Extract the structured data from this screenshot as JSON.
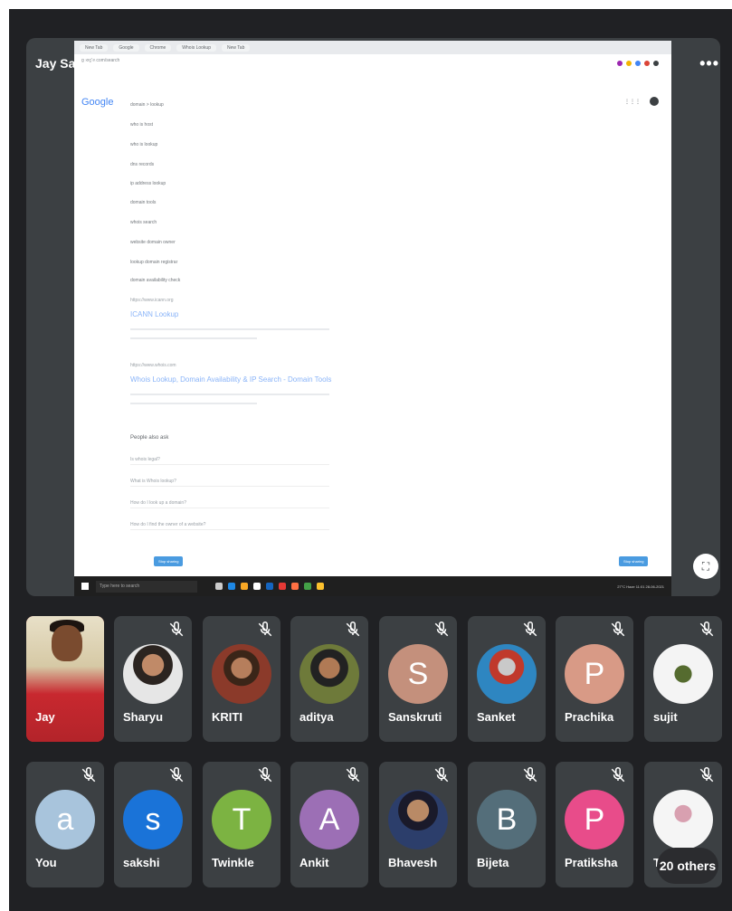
{
  "presenter": {
    "name": "Jay Sankh"
  },
  "toolbar": {
    "more_label": "•••",
    "fullscreen_icon": "fullscreen-icon"
  },
  "shared_screen": {
    "tabs": [
      "New Tab",
      "Google",
      "Chrome",
      "Whois Lookup",
      "New Tab"
    ],
    "address": "google.com/search",
    "google_logo": "Google",
    "suggestions": [
      "domain > lookup",
      "who is host",
      "who is lookup",
      "dns records",
      "ip address lookup",
      "domain tools",
      "whois search",
      "website domain owner",
      "lookup domain registrar",
      "domain availability check"
    ],
    "result1": {
      "url": "https://www.icann.org",
      "title": "ICANN Lookup"
    },
    "result2": {
      "url": "https://www.whois.com",
      "title": "Whois Lookup, Domain Availability & IP Search - Domain Tools"
    },
    "paa_heading": "People also ask",
    "paa": [
      "Is whois legal?",
      "What is Whois lookup?",
      "How do I look up a domain?",
      "How do I find the owner of a website?"
    ],
    "stop_label": "Stop sharing",
    "taskbar_search": "Type here to search",
    "tray_text": "27°C Haze  11:01  28-06-2021"
  },
  "row1": [
    {
      "name": "Jay",
      "initial": "",
      "color": ""
    },
    {
      "name": "Sharyu",
      "initial": "",
      "color": ""
    },
    {
      "name": "KRITI",
      "initial": "",
      "color": ""
    },
    {
      "name": "aditya",
      "initial": "",
      "color": ""
    },
    {
      "name": "Sanskruti",
      "initial": "S",
      "color": "#c4907c"
    },
    {
      "name": "Sanket",
      "initial": "",
      "color": ""
    },
    {
      "name": "Prachika",
      "initial": "P",
      "color": "#d89a86"
    },
    {
      "name": "sujit",
      "initial": "",
      "color": ""
    }
  ],
  "row2": [
    {
      "name": "You",
      "initial": "a",
      "color": "#a8c4dc"
    },
    {
      "name": "sakshi",
      "initial": "s",
      "color": "#1a73d8"
    },
    {
      "name": "Twinkle",
      "initial": "T",
      "color": "#7cb342"
    },
    {
      "name": "Ankit",
      "initial": "A",
      "color": "#9c6fb5"
    },
    {
      "name": "Bhavesh",
      "initial": "",
      "color": ""
    },
    {
      "name": "Bijeta",
      "initial": "B",
      "color": "#546e7a"
    },
    {
      "name": "Pratiksha",
      "initial": "P",
      "color": "#e84c8a"
    },
    {
      "name": "T",
      "initial": "",
      "color": ""
    }
  ],
  "others_label": "20 others"
}
